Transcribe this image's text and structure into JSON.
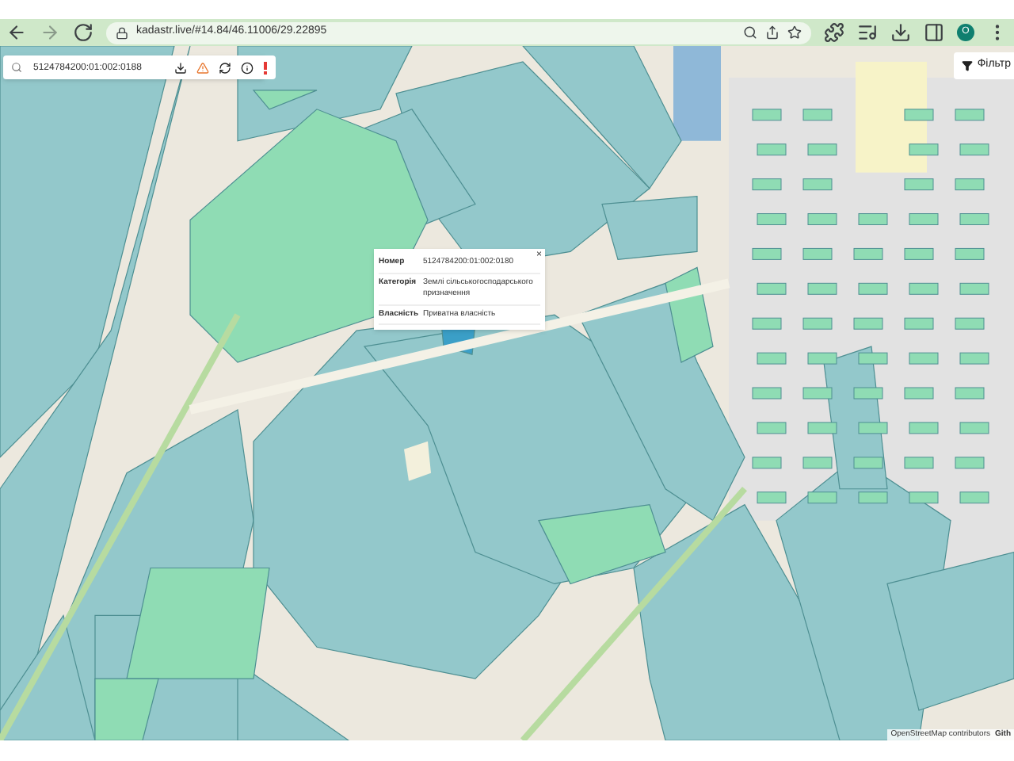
{
  "browser": {
    "url": "kadastr.live/#14.84/46.11006/29.22895",
    "avatar": "O"
  },
  "map_toolbar": {
    "search": {
      "value": "5124784200:01:002:0188"
    }
  },
  "filter_button": {
    "label": "Фільтр"
  },
  "popup": {
    "close": "×",
    "rows": [
      {
        "label": "Номер",
        "value": "5124784200:01:002:0180"
      },
      {
        "label": "Категорія",
        "value": "Землі сільськогосподарського призначення"
      },
      {
        "label": "Власність",
        "value": "Приватна власність"
      }
    ]
  },
  "attribution": {
    "text": "OpenStreetMap contributors",
    "link": "Gith"
  }
}
